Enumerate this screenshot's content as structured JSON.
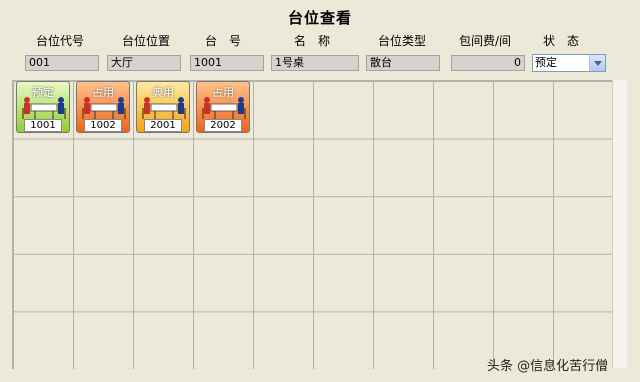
{
  "title": "台位查看",
  "labels": {
    "code": "台位代号",
    "location": "台位位置",
    "number": "台　号",
    "name": "名　称",
    "type": "台位类型",
    "fee": "包间费/间",
    "status": "状　态"
  },
  "fields": {
    "code": "001",
    "location": "大厅",
    "number": "1001",
    "name": "1号桌",
    "type": "散台",
    "fee": "0",
    "status": "预定"
  },
  "tables": [
    {
      "status": "预定",
      "number": "1001",
      "color": "#8fcf2e"
    },
    {
      "status": "占用",
      "number": "1002",
      "color": "#f0641a"
    },
    {
      "status": "典用",
      "number": "2001",
      "color": "#f3a512"
    },
    {
      "status": "占用",
      "number": "2002",
      "color": "#f0641a"
    }
  ],
  "watermark": "头条 @信息化苦行僧"
}
